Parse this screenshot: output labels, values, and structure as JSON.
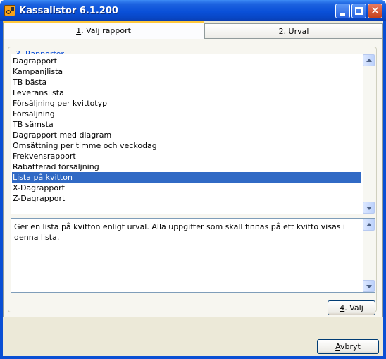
{
  "window": {
    "title": "Kassalistor 6.1.200"
  },
  "tabs": [
    {
      "accel": "1",
      "rest": ". Välj rapport"
    },
    {
      "accel": "2",
      "rest": ". Urval"
    }
  ],
  "group": {
    "accel": "3",
    "rest": ". Rapporter"
  },
  "reports": [
    "Dagrapport",
    "Kampanjlista",
    "TB bästa",
    "Leveranslista",
    "Försäljning per kvittotyp",
    "Försäljning",
    "TB sämsta",
    "Dagrapport med diagram",
    "Omsättning per timme och veckodag",
    "Frekvensrapport",
    "Rabatterad försäljning",
    "Lista på kvitton",
    "X-Dagrapport",
    "Z-Dagrapport"
  ],
  "selected_report": "Lista på kvitton",
  "description": "Ger en lista på kvitton enligt urval. Alla uppgifter som skall finnas på ett kvitto visas i denna lista.",
  "buttons": {
    "valj": {
      "accel": "4",
      "rest": ". Välj"
    },
    "avbryt": {
      "accel": "A",
      "rest": "vbryt"
    }
  },
  "colors": {
    "titlebar": "#0a50d8",
    "selection": "#316ac5",
    "group_label": "#0046d5",
    "active_tab_highlight": "#ffc83c"
  }
}
